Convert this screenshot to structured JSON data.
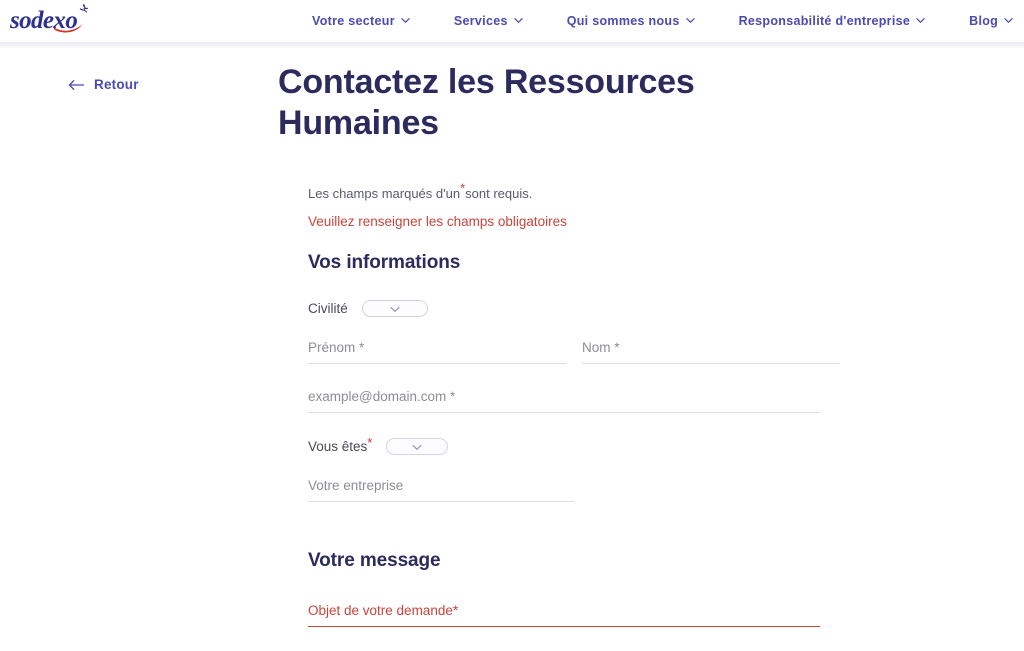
{
  "header": {
    "logo_text": "sodexo",
    "nav_items": [
      {
        "label": "Votre secteur",
        "icon": "chevron-down-icon"
      },
      {
        "label": "Services",
        "icon": "chevron-down-icon"
      },
      {
        "label": "Qui sommes nous",
        "icon": "chevron-down-icon"
      },
      {
        "label": "Responsabilité d'entreprise",
        "icon": "chevron-down-icon"
      },
      {
        "label": "Blog",
        "icon": "chevron-down-icon"
      }
    ]
  },
  "back": {
    "label": "Retour",
    "icon": "arrow-left-icon"
  },
  "page": {
    "title": "Contactez les Ressources Humaines"
  },
  "form": {
    "required_note_prefix": "Les champs marqués d'un",
    "required_note_star": "*",
    "required_note_suffix": "sont requis.",
    "error_message": "Veuillez renseigner les champs obligatoires",
    "sections": [
      {
        "title": "Vos informations"
      },
      {
        "title": "Votre message"
      }
    ],
    "fields": {
      "civilite_label": "Civilité",
      "civilite_value": "",
      "prenom_placeholder": "Prénom *",
      "nom_placeholder": "Nom *",
      "email_placeholder": "example@domain.com *",
      "vous_etes_label": "Vous êtes",
      "vous_etes_star": "*",
      "vous_etes_value": "",
      "entreprise_placeholder": "Votre entreprise",
      "objet_placeholder": "Objet de votre demande*"
    }
  },
  "colors": {
    "brand_navy": "#2b2b5e",
    "brand_blue": "#4a4ab0",
    "logo_red": "#d0352b",
    "error_red": "#c8453c",
    "placeholder_gray": "#8d8d99",
    "underline_gray": "#dcdce4"
  }
}
